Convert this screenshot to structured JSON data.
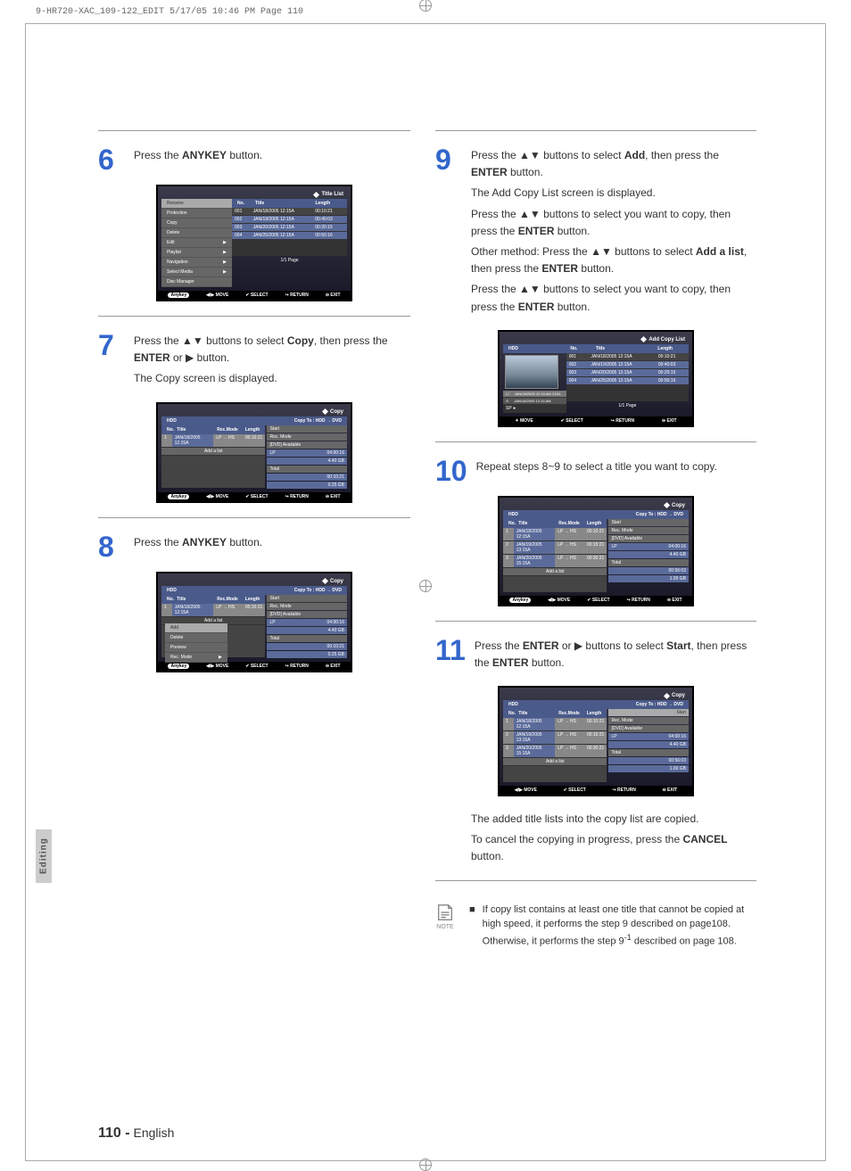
{
  "header_meta": "9-HR720-XAC_109-122_EDIT  5/17/05  10:46 PM  Page 110",
  "side_tab": "Editing",
  "page_footer_num": "110 -",
  "page_footer_lang": "English",
  "steps": {
    "s6": {
      "num": "6",
      "l1a": "Press the ",
      "l1b": "ANYKEY",
      "l1c": " button."
    },
    "s7": {
      "num": "7",
      "l1a": "Press the ▲▼ buttons to select ",
      "l1b": "Copy",
      "l1c": ", then press the ",
      "l2a": "ENTER",
      "l2b": " or ▶ button.",
      "l3": "The Copy screen is displayed."
    },
    "s8": {
      "num": "8",
      "l1a": "Press the ",
      "l1b": "ANYKEY",
      "l1c": " button."
    },
    "s9": {
      "num": "9",
      "l1a": "Press the ▲▼ buttons to select ",
      "l1b": "Add",
      "l1c": ", then press the ",
      "l2a": "ENTER",
      "l2b": " button.",
      "l3": "The Add Copy List screen is displayed.",
      "l4a": "Press the ▲▼ buttons to select you want to copy, then press the ",
      "l4b": "ENTER",
      "l4c": " button.",
      "l5a": "Other method: Press the ▲▼ buttons to select ",
      "l5b": "Add a list",
      "l5c": ", then press the ",
      "l5d": "ENTER",
      "l5e": " button.",
      "l6a": "Press the ▲▼ buttons to select you want to copy, then press the ",
      "l6b": "ENTER",
      "l6c": " button."
    },
    "s10": {
      "num": "10",
      "l1": "Repeat steps 8~9 to select a title you want to copy."
    },
    "s11": {
      "num": "11",
      "l1a": "Press the ",
      "l1b": "ENTER",
      "l1c": " or ▶ buttons to select ",
      "l1d": "Start",
      "l1e": ", then press the ",
      "l2a": "ENTER",
      "l2b": " button.",
      "post1": "The added title lists into the copy list are copied.",
      "post2a": "To cancel the copying in progress, press the ",
      "post2b": "CANCEL",
      "post2c": " button."
    }
  },
  "note": {
    "label": "NOTE",
    "bullet": "■",
    "text1": "If copy list contains at least one title that cannot be copied at high speed, it performs the step 9 described on page108. Otherwise, it performs the step 9",
    "sup": "-1",
    "text2": " described on page 108."
  },
  "ss6": {
    "title": "Title List",
    "menu": [
      "Rename",
      "Protection",
      "Copy",
      "Delete",
      "Edit",
      "Playlist",
      "Navigation",
      "Select Media",
      "Disc Manager"
    ],
    "hdr": {
      "no": "No.",
      "title": "Title",
      "len": "Length"
    },
    "rows": [
      {
        "no": "001",
        "t": "JAN/18/2005 12:15A",
        "l": "00:10:21"
      },
      {
        "no": "002",
        "t": "JAN/19/2005 12:15A",
        "l": "00:40:03"
      },
      {
        "no": "003",
        "t": "JAN/20/2005 12:15A",
        "l": "00:20:15"
      },
      {
        "no": "004",
        "t": "JAN/25/2005 12:15A",
        "l": "00:50:16"
      }
    ],
    "page": "1/1 Page",
    "footer": [
      "◀I▶ MOVE",
      "✔ SELECT",
      "↪ RETURN",
      "⊖ EXIT"
    ],
    "anykey": "Anykey"
  },
  "ss7": {
    "title": "Copy",
    "hdd": "HDD",
    "dir": "Copy To : HDD → DVD",
    "hdr": {
      "no": "No.",
      "title": "Title",
      "mode": "Rec.Mode",
      "len": "Length"
    },
    "rows": [
      {
        "no": "1",
        "t": "JAN/18/2005 12:15A",
        "m": "LP → HS",
        "l": "00:10:21"
      }
    ],
    "add": "Add a list",
    "info": {
      "start": "Start",
      "recmode": "Rec. Mode",
      "avail": "[DVD] Available",
      "lp": "LP",
      "lpv": "04:00:16",
      "lpg": "4.40 GB",
      "total": "Total",
      "tv": "00:10:21",
      "tg": "0.25 GB"
    },
    "footer": [
      "◀I▶ MOVE",
      "✔ SELECT",
      "↪ RETURN",
      "⊖ EXIT"
    ],
    "anykey": "Anykey"
  },
  "ss8": {
    "title": "Copy",
    "hdd": "HDD",
    "dir": "Copy To : HDD → DVD",
    "hdr": {
      "no": "No.",
      "title": "Title",
      "mode": "Rec.Mode",
      "len": "Length"
    },
    "rows": [
      {
        "no": "1",
        "t": "JAN/18/2005 12:15A",
        "m": "LP → HS",
        "l": "00:10:21"
      }
    ],
    "menu": [
      "Add",
      "Delete",
      "Preview",
      "Rec. Mode"
    ],
    "add": "Add a list",
    "info": {
      "start": "Start",
      "recmode": "Rec. Mode",
      "avail": "[DVD] Available",
      "lp": "LP",
      "lpv": "04:00:16",
      "lpg": "4.40 GB",
      "total": "Total",
      "tv": "00:10:21",
      "tg": "0.25 GB"
    },
    "footer": [
      "◀I▶ MOVE",
      "✔ SELECT",
      "↪ RETURN",
      "⊖ EXIT"
    ],
    "anykey": "Anykey"
  },
  "ss9": {
    "title": "Add Copy List",
    "hdd": "HDD",
    "hdr": {
      "no": "No.",
      "title": "Title",
      "len": "Length"
    },
    "rows": [
      {
        "no": "001",
        "t": "JAN/18/2005 12:15A",
        "l": "00:10:21"
      },
      {
        "no": "002",
        "t": "JAN/19/2005 12:15A",
        "l": "00:40:03"
      },
      {
        "no": "003",
        "t": "JAN/20/2005 12:15A",
        "l": "00:20:15"
      },
      {
        "no": "004",
        "t": "JAN/25/2005 12:15A",
        "l": "00:50:16"
      }
    ],
    "chip1": "JAN/18/2005 12:15 AM CH11",
    "chip2": "JAN/18/2005 12:15 AM",
    "sp": "SP ●",
    "page": "1/1 Page",
    "footer": [
      "✦ MOVE",
      "✔ SELECT",
      "↪ RETURN",
      "⊖ EXIT"
    ]
  },
  "ss10": {
    "title": "Copy",
    "hdd": "HDD",
    "dir": "Copy To : HDD → DVD",
    "hdr": {
      "no": "No.",
      "title": "Title",
      "mode": "Rec.Mode",
      "len": "Length"
    },
    "rows": [
      {
        "no": "1",
        "t": "JAN/18/2005 12:15A",
        "m": "LP → HS",
        "l": "00:10:21"
      },
      {
        "no": "2",
        "t": "JAN/19/2005 13:15A",
        "m": "LP → HS",
        "l": "00:15:21"
      },
      {
        "no": "3",
        "t": "JAN/20/2005 15:15A",
        "m": "LP → HS",
        "l": "00:30:21"
      }
    ],
    "add": "Add a list",
    "info": {
      "start": "Start",
      "recmode": "Rec. Mode",
      "avail": "[DVD] Available",
      "lp": "LP",
      "lpv": "04:00:16",
      "lpg": "4.40 GB",
      "total": "Total",
      "tv": "00:56:03",
      "tg": "1.00 GB"
    },
    "footer": [
      "◀I▶ MOVE",
      "✔ SELECT",
      "↪ RETURN",
      "⊖ EXIT"
    ],
    "anykey": "Anykey"
  },
  "ss11": {
    "title": "Copy",
    "hdd": "HDD",
    "dir": "Copy To : HDD → DVD",
    "hdr": {
      "no": "No.",
      "title": "Title",
      "mode": "Rec.Mode",
      "len": "Length"
    },
    "rows": [
      {
        "no": "1",
        "t": "JAN/18/2005 12:15A",
        "m": "LP → HS",
        "l": "00:10:21"
      },
      {
        "no": "2",
        "t": "JAN/19/2005 13:15A",
        "m": "LP → HS",
        "l": "00:15:21"
      },
      {
        "no": "3",
        "t": "JAN/20/2005 15:15A",
        "m": "LP → HS",
        "l": "00:30:21"
      }
    ],
    "add": "Add a list",
    "info": {
      "start": "Start",
      "recmode": "Rec. Mode",
      "avail": "[DVD] Available",
      "lp": "LP",
      "lpv": "04:00:16",
      "lpg": "4.40 GB",
      "total": "Total",
      "tv": "00:56:03",
      "tg": "1.00 GB"
    },
    "footer": [
      "◀I▶ MOVE",
      "✔ SELECT",
      "↪ RETURN",
      "⊖ EXIT"
    ]
  }
}
